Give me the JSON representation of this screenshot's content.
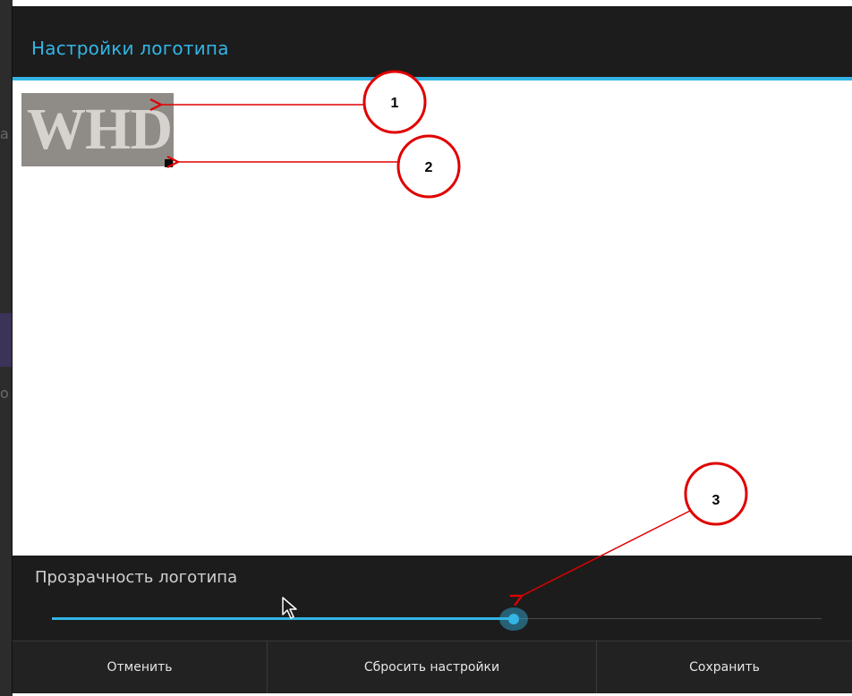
{
  "dialog": {
    "title": "Настройки логотипа",
    "logo_text": "WHD",
    "opacity_label": "Прозрачность логотипа",
    "opacity_value": 0.6,
    "buttons": {
      "cancel": "Отменить",
      "reset": "Сбросить настройки",
      "save": "Сохранить"
    }
  },
  "background": {
    "fragment_1": "а",
    "fragment_2": "о"
  },
  "callouts": [
    "1",
    "2",
    "3"
  ],
  "colors": {
    "accent": "#33b5e5",
    "dialog_bg": "#1c1c1c",
    "callout": "#e00000"
  }
}
